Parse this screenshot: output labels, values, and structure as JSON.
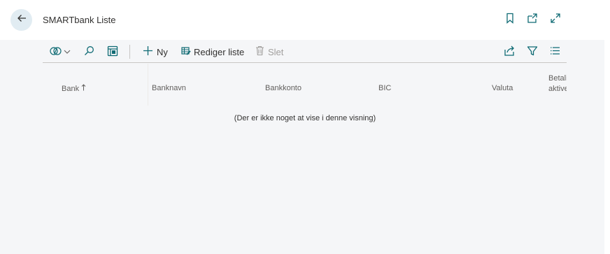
{
  "header": {
    "title": "SMARTbank Liste"
  },
  "toolbar": {
    "new_label": "Ny",
    "edit_list_label": "Rediger liste",
    "delete_label": "Slet"
  },
  "columns": {
    "bank": "Bank",
    "banknavn": "Banknavn",
    "bankkonto": "Bankkonto",
    "bic": "BIC",
    "valuta": "Valuta",
    "betaling_line1": "Betali",
    "betaling_line2": "aktive"
  },
  "empty_message": "(Der er ikke noget at vise i denne visning)",
  "colors": {
    "accent": "#00796b",
    "back_button_bg": "#e1ecf2",
    "icon_teal": "#0f6b74"
  }
}
